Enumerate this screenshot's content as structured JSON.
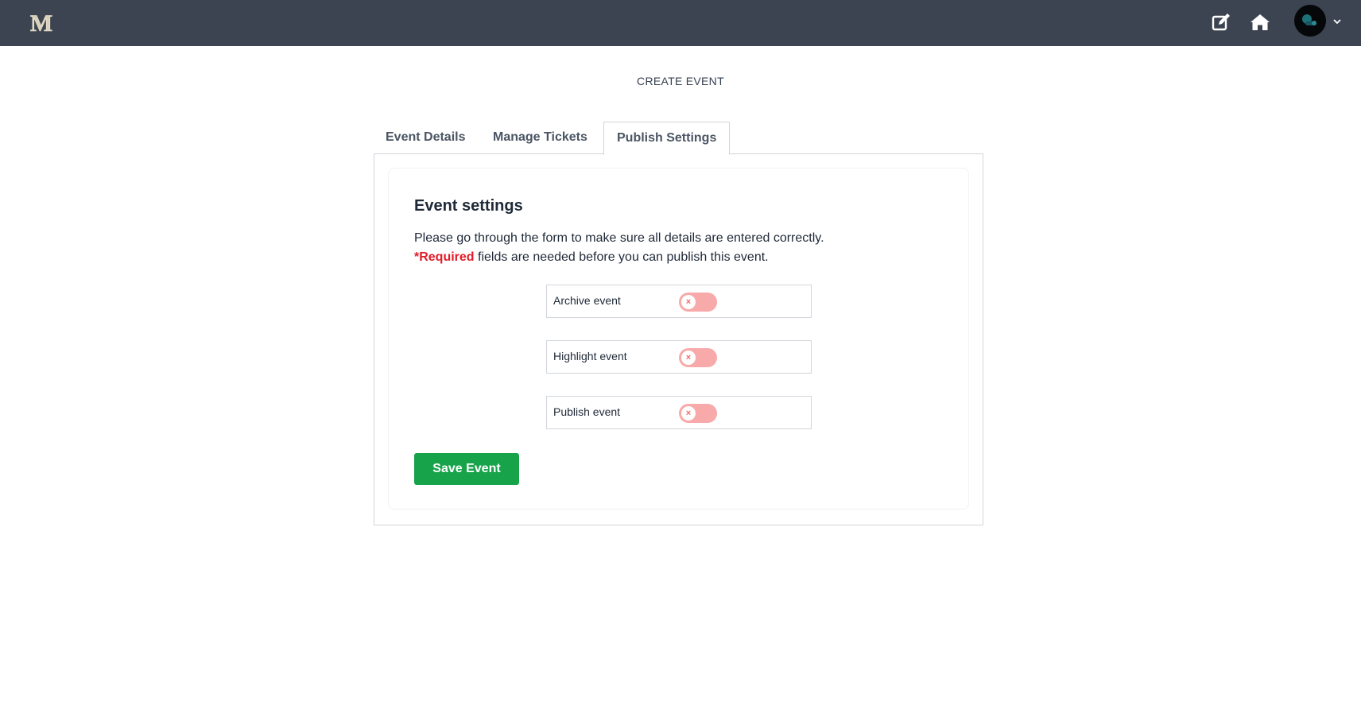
{
  "topbar": {
    "logo_letter": "M",
    "icons": [
      "edit-icon",
      "home-icon",
      "avatar",
      "chevron-down-icon"
    ],
    "background_color": "#3d4451"
  },
  "page": {
    "heading": "CREATE EVENT"
  },
  "tabs": [
    {
      "label": "Event Details",
      "active": false
    },
    {
      "label": "Manage Tickets",
      "active": false
    },
    {
      "label": "Publish Settings",
      "active": true
    }
  ],
  "settings_card": {
    "title": "Event settings",
    "description_line1": "Please go through the form to make sure all details are entered correctly.",
    "required_marker": "*Required",
    "description_line2_rest": " fields are needed before you can publish this event.",
    "toggles": [
      {
        "label": "Archive event",
        "checked": false
      },
      {
        "label": "Highlight event",
        "checked": false
      },
      {
        "label": "Publish event",
        "checked": false
      }
    ],
    "save_label": "Save Event"
  },
  "colors": {
    "accent_green": "#16a34a",
    "required_red": "#e11d2a",
    "toggle_off": "#f8a9a9"
  }
}
